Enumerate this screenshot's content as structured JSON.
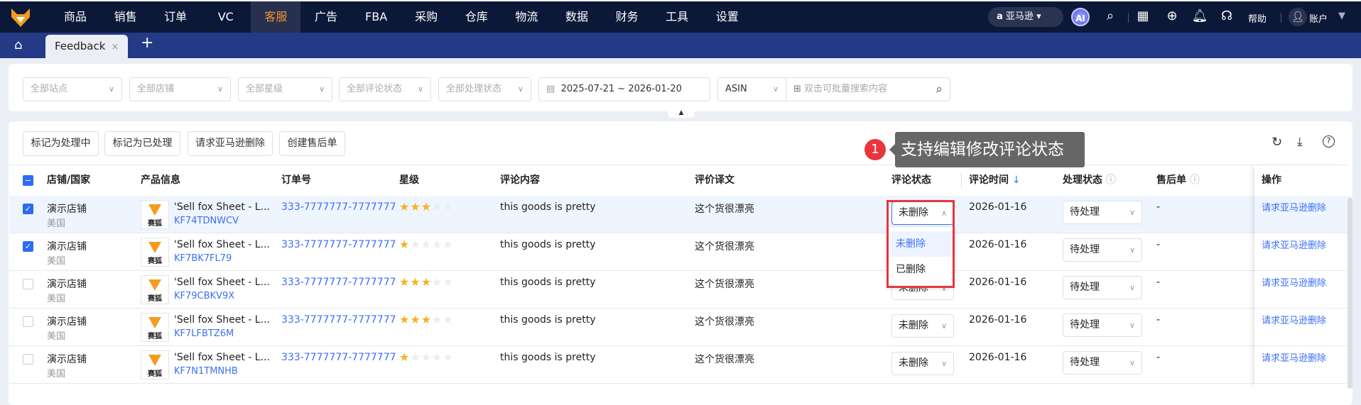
{
  "nav": {
    "items": [
      "商品",
      "销售",
      "订单",
      "VC",
      "客服",
      "广告",
      "FBA",
      "采购",
      "仓库",
      "物流",
      "数据",
      "财务",
      "工具",
      "设置"
    ],
    "active": "客服",
    "platform": "亚马逊",
    "ai": "AI",
    "help": "帮助",
    "account": "账户",
    "accent": "#f7932d"
  },
  "tabs": {
    "items": [
      {
        "label": "Feedback"
      }
    ],
    "close": "×",
    "add": "+"
  },
  "filters": {
    "site": "全部站点",
    "shop": "全部店铺",
    "rating": "全部星级",
    "review_status": "全部评论状态",
    "process_status": "全部处理状态",
    "date_start": "2025-07-21",
    "date_sep": "~",
    "date_end": "2026-01-20",
    "search_type": "ASIN",
    "search_placeholder": "双击可批量搜索内容"
  },
  "toolbar": {
    "buttons": [
      "标记为处理中",
      "标记为已处理",
      "请求亚马逊删除",
      "创建售后单"
    ]
  },
  "tooltip": {
    "step": "1",
    "text": "支持编辑修改评论状态"
  },
  "table": {
    "headers": {
      "shop": "店铺/国家",
      "product": "产品信息",
      "order": "订单号",
      "rating": "星级",
      "content": "评论内容",
      "translation": "评价译文",
      "review_status": "评论状态",
      "review_time": "评论时间",
      "sort": "↓",
      "process_status": "处理状态",
      "after_sale": "售后单",
      "action": "操作"
    },
    "rows": [
      {
        "checked": true,
        "shop": "演示店铺",
        "country": "美国",
        "product": "'Sell fox Sheet - L...",
        "sku": "KF74TDNWCV",
        "thumb": "赛狐",
        "order": "333-7777777-7777777",
        "stars": 3,
        "content": "this goods is pretty",
        "translation": "这个货很漂亮",
        "review_status": "未删除",
        "review_time": "2026-01-16",
        "process_status": "待处理",
        "after_sale": "-",
        "action": "请求亚马逊删除"
      },
      {
        "checked": true,
        "shop": "演示店铺",
        "country": "美国",
        "product": "'Sell fox Sheet - L...",
        "sku": "KF7BK7FL79",
        "thumb": "赛狐",
        "order": "333-7777777-7777777",
        "stars": 1,
        "content": "this goods is pretty",
        "translation": "这个货很漂亮",
        "review_status": "未删除",
        "review_time": "2026-01-16",
        "process_status": "待处理",
        "after_sale": "-",
        "action": "请求亚马逊删除"
      },
      {
        "checked": false,
        "shop": "演示店铺",
        "country": "美国",
        "product": "'Sell fox Sheet - L...",
        "sku": "KF79CBKV9X",
        "thumb": "赛狐",
        "order": "333-7777777-7777777",
        "stars": 3,
        "content": "this goods is pretty",
        "translation": "这个货很漂亮",
        "review_status": "未删除",
        "review_time": "2026-01-16",
        "process_status": "待处理",
        "after_sale": "-",
        "action": "请求亚马逊删除"
      },
      {
        "checked": false,
        "shop": "演示店铺",
        "country": "美国",
        "product": "'Sell fox Sheet - L...",
        "sku": "KF7LFBTZ6M",
        "thumb": "赛狐",
        "order": "333-7777777-7777777",
        "stars": 3,
        "content": "this goods is pretty",
        "translation": "这个货很漂亮",
        "review_status": "未删除",
        "review_time": "2026-01-16",
        "process_status": "待处理",
        "after_sale": "-",
        "action": "请求亚马逊删除"
      },
      {
        "checked": false,
        "shop": "演示店铺",
        "country": "美国",
        "product": "'Sell fox Sheet - L...",
        "sku": "KF7N1TMNHB",
        "thumb": "赛狐",
        "order": "333-7777777-7777777",
        "stars": 1,
        "content": "this goods is pretty",
        "translation": "这个货很漂亮",
        "review_status": "未删除",
        "review_time": "2026-01-16",
        "process_status": "待处理",
        "after_sale": "-",
        "action": "请求亚马逊删除"
      }
    ]
  },
  "dropdown": {
    "options": [
      "未删除",
      "已删除"
    ],
    "selected": "未删除"
  }
}
